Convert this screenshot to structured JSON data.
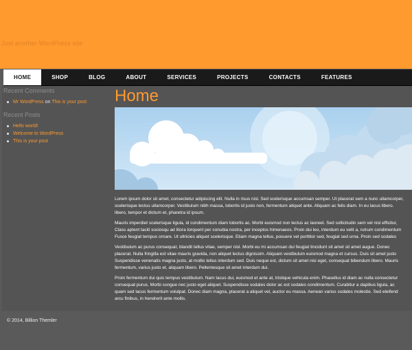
{
  "header": {
    "tagline": "Just another WordPress site",
    "bg_color": "#ff9a2e"
  },
  "nav": {
    "items": [
      {
        "label": "HOME",
        "active": true
      },
      {
        "label": "SHOP"
      },
      {
        "label": "BLOG"
      },
      {
        "label": "ABOUT"
      },
      {
        "label": "SERVICES"
      },
      {
        "label": "PROJECTS"
      },
      {
        "label": "CONTACTS"
      },
      {
        "label": "FEATURES"
      }
    ]
  },
  "sidebar": {
    "recent_comments_title": "Recent Comments",
    "comment": {
      "author": "Mr WordPress",
      "on": "on",
      "post": "This is your post"
    },
    "recent_posts_title": "Recent Posts",
    "posts": [
      "Hello world!",
      "Welcome to WordPress",
      "This is your post"
    ]
  },
  "main": {
    "title": "Home",
    "paragraphs": [
      [
        "Lorem ipsum dolor sit amet, consectetur adipiscing elit. Nulla in risus nisl. Sed scelerisque accumsan semper. Ut placerat sem a nunc ullamcorper,",
        "scelerisque lectus ullamcorper. Vestibulum nibh massa, lobortis id justo non, fermentum aliquet ante. Aliquam ac felis diam. In eu lacus libero.",
        "libero, tempor et dictum et, pharetra id ipsum."
      ],
      [
        "Mauris imperdiet scelerisque ligula, id condimentum diam lobortis ac. Morbi euismod non lectus ac laoreet. Sed sollicitudin sem vel nisl efficitur,",
        "Class aptent taciti sociosqu ad litora torquent per conubia nostra, per inceptos himenaeos. Proin dui leo, interdum eu velit a, rutrum condimentum",
        "Fusce feugiat tempus ornare. Ut ultricies aliquet scelerisque. Etiam magna tellus, posuere vel porttitor sed, feugiat sed urna. Proin sed sodales"
      ],
      [
        "Vestibulum ac purus consequat, blandit tellus vitae, semper nisl. Morbi eu mi accumsan dui feugiat tincidunt sit amet sit amet augue. Donec",
        "placerat. Nulla fringilla est vitae mauris gravida, non aliquet lectus dignissim. Aliquam vestibulum euismod magna et cursus. Duis sit amet justo",
        "Suspendisse venenatis magna justo, at mollis tellus interdum sed. Duis neque est, dictum sit amet nisi eget, consequat bibendum libero. Mauris",
        "fermentum, varius justo et, aliquam libero. Pellentesque sit amet interdum dui."
      ],
      [
        "Proin fermentum dui quis tempus vestibulum. Nam lacus dui, euismod et ante at, tristique vehicula enim. Phasellus id diam ac nulla consectetur",
        "consequat purus. Morbi congue nec justo eget aliquet. Suspendisse sodales dolor ac est sodales condimentum. Curabitur a dapibus ligula, ac",
        "quam sed lacus fermentum volutpat. Donec diam magna, placerat a aliquet vel, auctor eu massa. Aenean varius sodales molestie. Sed eleifend",
        "arcu finibus, in hendrerit ante mollis."
      ]
    ]
  },
  "footer": {
    "copyright": "© 2014, Billion Themler"
  }
}
